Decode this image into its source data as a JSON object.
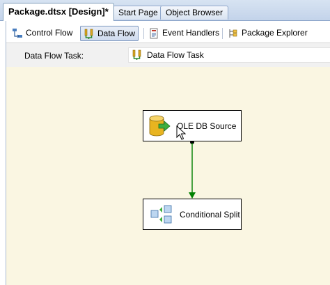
{
  "document_tabs": [
    {
      "label": "Package.dtsx [Design]*",
      "active": true
    },
    {
      "label": "Start Page",
      "active": false
    },
    {
      "label": "Object Browser",
      "active": false
    }
  ],
  "designer_tabs": [
    {
      "label": "Control Flow",
      "icon": "control-flow-icon",
      "active": false
    },
    {
      "label": "Data Flow",
      "icon": "data-flow-icon",
      "active": true
    },
    {
      "label": "Event Handlers",
      "icon": "event-handlers-icon",
      "active": false
    },
    {
      "label": "Package Explorer",
      "icon": "package-explorer-icon",
      "active": false
    }
  ],
  "task_row": {
    "label": "Data Flow Task:",
    "selected_task": "Data Flow Task",
    "selected_icon": "data-flow-task-icon"
  },
  "canvas": {
    "components": [
      {
        "label": "OLE DB Source",
        "icon": "ole-db-source-icon"
      },
      {
        "label": "Conditional Split",
        "icon": "conditional-split-icon"
      }
    ],
    "connector_color": "#008000"
  },
  "colors": {
    "canvas_background": "#faf6e2",
    "tab_strip": "#c3d3ea"
  }
}
